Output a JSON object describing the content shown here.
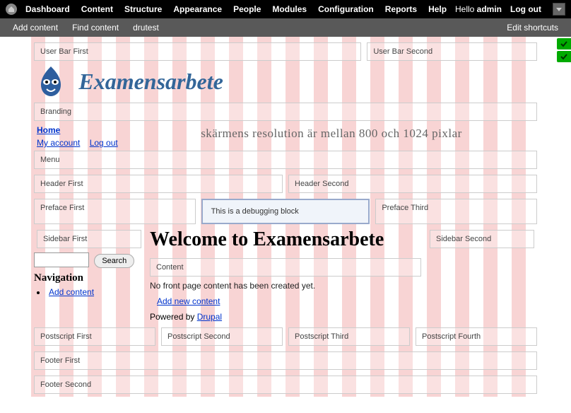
{
  "admin_menu": {
    "items": [
      "Dashboard",
      "Content",
      "Structure",
      "Appearance",
      "People",
      "Modules",
      "Configuration",
      "Reports",
      "Help"
    ],
    "hello_prefix": "Hello ",
    "hello_user": "admin",
    "logout": "Log out"
  },
  "shortcuts": {
    "items": [
      "Add content",
      "Find content",
      "drutest"
    ],
    "edit": "Edit shortcuts"
  },
  "regions": {
    "user_bar_first": "User Bar First",
    "user_bar_second": "User Bar Second",
    "branding": "Branding",
    "menu": "Menu",
    "header_first": "Header First",
    "header_second": "Header Second",
    "preface_first": "Preface First",
    "preface_third": "Preface Third",
    "sidebar_first": "Sidebar First",
    "sidebar_second": "Sidebar Second",
    "content": "Content",
    "postscript_first": "Postscript First",
    "postscript_second": "Postscript Second",
    "postscript_third": "Postscript Third",
    "postscript_fourth": "Postscript Fourth",
    "footer_first": "Footer First",
    "footer_second": "Footer Second"
  },
  "site": {
    "title": "Examensarbete"
  },
  "menu_links": {
    "home": "Home",
    "my_account": "My account",
    "logout": "Log out"
  },
  "resolution_msg": "skärmens resolution är mellan 800 och 1024 pixlar",
  "debug_block": "This is a debugging block",
  "main": {
    "welcome": "Welcome to Examensarbete",
    "no_content": "No front page content has been created yet.",
    "add_new": "Add new content",
    "powered_prefix": "Powered by ",
    "powered_link": "Drupal"
  },
  "sidebar": {
    "search_button": "Search",
    "nav_title": "Navigation",
    "nav_items": [
      "Add content"
    ]
  }
}
